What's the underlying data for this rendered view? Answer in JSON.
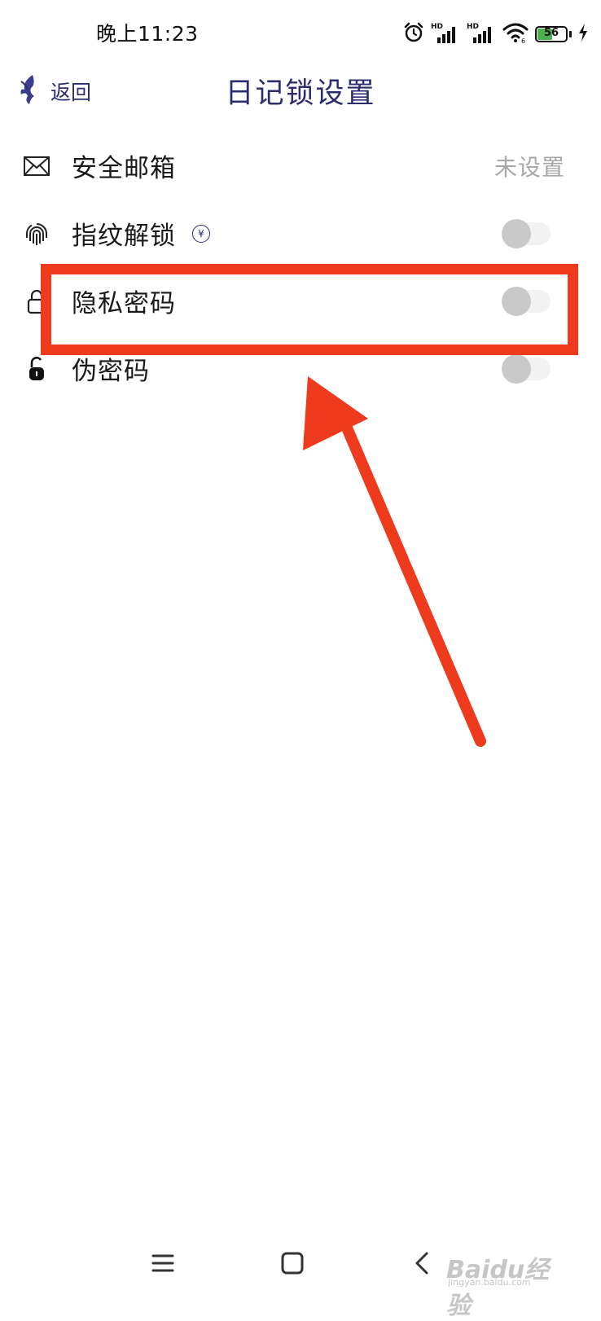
{
  "status_bar": {
    "time": "晚上11:23",
    "battery_level": "56",
    "battery_percent": 56,
    "icons": [
      "alarm-icon",
      "signal-hd-1-icon",
      "signal-hd-2-icon",
      "wifi-icon",
      "battery-icon",
      "charging-icon"
    ]
  },
  "header": {
    "back_label": "返回",
    "title": "日记锁设置"
  },
  "settings": {
    "items": [
      {
        "label": "安全邮箱",
        "icon": "mail-icon",
        "value": "未设置"
      },
      {
        "label": "指纹解锁",
        "icon": "fingerprint-icon",
        "badge": "¥",
        "toggle_on": false
      },
      {
        "label": "隐私密码",
        "icon": "lock-icon",
        "toggle_on": false
      },
      {
        "label": "伪密码",
        "icon": "unlock-icon",
        "toggle_on": false
      }
    ]
  },
  "nav_bar": {
    "icons": [
      "menu-icon",
      "home-icon",
      "back-icon"
    ]
  },
  "watermark": {
    "text": "Baidu经验",
    "sub": "jingyan.baidu.com"
  },
  "colors": {
    "accent": "#2b2d6e",
    "annotation": "#ee3a1d",
    "toggle_off_knob": "#c9c9c9",
    "toggle_off_track": "#f2f2f2",
    "value_gray": "#a8a8a8"
  }
}
